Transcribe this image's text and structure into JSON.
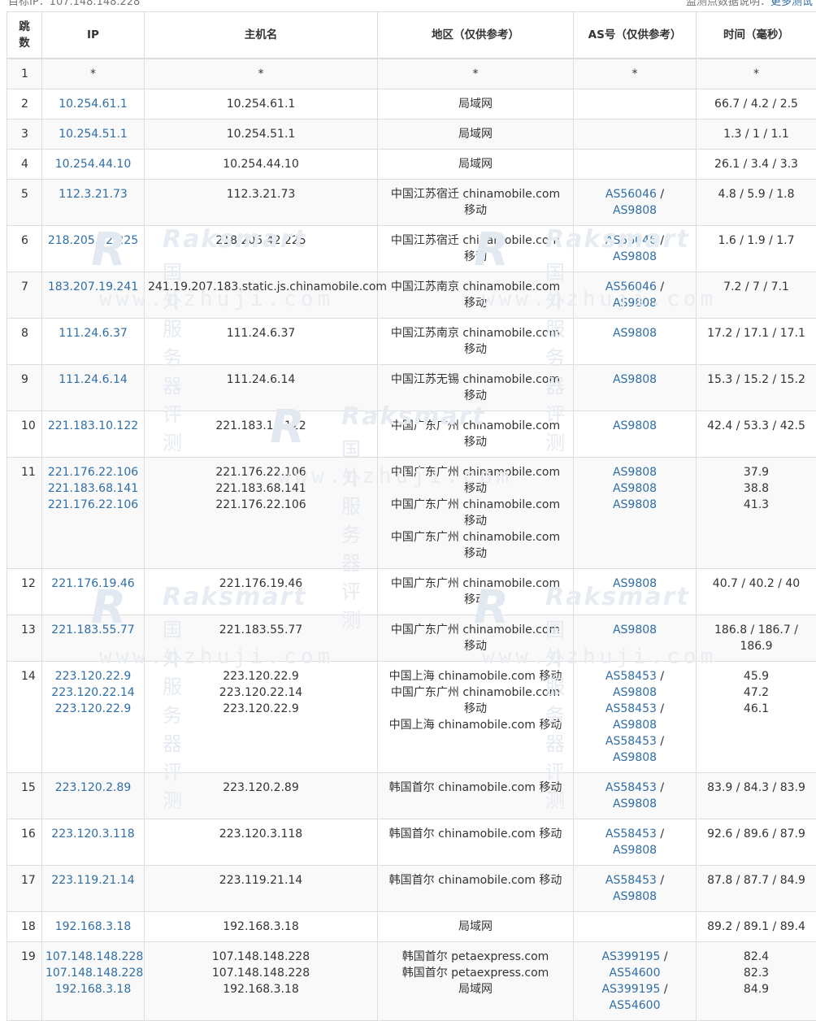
{
  "top_bar": {
    "left_text": "目标IP：107.148.148.228",
    "right_text": "监测点数据说明：",
    "right_link": "更多测试"
  },
  "watermark": {
    "brand": "Raksmart",
    "cn": "国外服务器评测",
    "url": "www.qzhuji.com"
  },
  "table": {
    "headers": [
      "跳数",
      "IP",
      "主机名",
      "地区（仅供参考）",
      "AS号（仅供参考）",
      "时间（毫秒）"
    ],
    "rows": [
      {
        "hop": "1",
        "ips": [
          "*"
        ],
        "hosts": [
          "*"
        ],
        "regions": [
          "*"
        ],
        "as": [
          [
            "*"
          ]
        ],
        "times": [
          "*"
        ]
      },
      {
        "hop": "2",
        "ips": [
          "10.254.61.1"
        ],
        "hosts": [
          "10.254.61.1"
        ],
        "regions": [
          "局域网"
        ],
        "as": [],
        "times": [
          "66.7 / 4.2 / 2.5"
        ]
      },
      {
        "hop": "3",
        "ips": [
          "10.254.51.1"
        ],
        "hosts": [
          "10.254.51.1"
        ],
        "regions": [
          "局域网"
        ],
        "as": [],
        "times": [
          "1.3 / 1 / 1.1"
        ]
      },
      {
        "hop": "4",
        "ips": [
          "10.254.44.10"
        ],
        "hosts": [
          "10.254.44.10"
        ],
        "regions": [
          "局域网"
        ],
        "as": [],
        "times": [
          "26.1 / 3.4 / 3.3"
        ]
      },
      {
        "hop": "5",
        "ips": [
          "112.3.21.73"
        ],
        "hosts": [
          "112.3.21.73"
        ],
        "regions": [
          "中国江苏宿迁 chinamobile.com 移动"
        ],
        "as": [
          [
            "AS56046",
            "AS9808"
          ]
        ],
        "times": [
          "4.8 / 5.9 / 1.8"
        ]
      },
      {
        "hop": "6",
        "ips": [
          "218.205.42.225"
        ],
        "hosts": [
          "218.205.42.225"
        ],
        "regions": [
          "中国江苏宿迁 chinamobile.com 移动"
        ],
        "as": [
          [
            "AS56046",
            "AS9808"
          ]
        ],
        "times": [
          "1.6 / 1.9 / 1.7"
        ]
      },
      {
        "hop": "7",
        "ips": [
          "183.207.19.241"
        ],
        "hosts": [
          "241.19.207.183.static.js.chinamobile.com"
        ],
        "regions": [
          "中国江苏南京 chinamobile.com 移动"
        ],
        "as": [
          [
            "AS56046",
            "AS9808"
          ]
        ],
        "times": [
          "7.2 / 7 / 7.1"
        ]
      },
      {
        "hop": "8",
        "ips": [
          "111.24.6.37"
        ],
        "hosts": [
          "111.24.6.37"
        ],
        "regions": [
          "中国江苏南京 chinamobile.com 移动"
        ],
        "as": [
          [
            "AS9808"
          ]
        ],
        "times": [
          "17.2 / 17.1 / 17.1"
        ]
      },
      {
        "hop": "9",
        "ips": [
          "111.24.6.14"
        ],
        "hosts": [
          "111.24.6.14"
        ],
        "regions": [
          "中国江苏无锡 chinamobile.com 移动"
        ],
        "as": [
          [
            "AS9808"
          ]
        ],
        "times": [
          "15.3 / 15.2 / 15.2"
        ]
      },
      {
        "hop": "10",
        "ips": [
          "221.183.10.122"
        ],
        "hosts": [
          "221.183.10.122"
        ],
        "regions": [
          "中国广东广州 chinamobile.com 移动"
        ],
        "as": [
          [
            "AS9808"
          ]
        ],
        "times": [
          "42.4 / 53.3 / 42.5"
        ]
      },
      {
        "hop": "11",
        "ips": [
          "221.176.22.106",
          "221.183.68.141",
          "221.176.22.106"
        ],
        "hosts": [
          "221.176.22.106",
          "221.183.68.141",
          "221.176.22.106"
        ],
        "regions": [
          "中国广东广州 chinamobile.com 移动",
          "中国广东广州 chinamobile.com 移动",
          "中国广东广州 chinamobile.com 移动"
        ],
        "as": [
          [
            "AS9808"
          ],
          [
            "AS9808"
          ],
          [
            "AS9808"
          ]
        ],
        "times": [
          "37.9",
          "38.8",
          "41.3"
        ]
      },
      {
        "hop": "12",
        "ips": [
          "221.176.19.46"
        ],
        "hosts": [
          "221.176.19.46"
        ],
        "regions": [
          "中国广东广州 chinamobile.com 移动"
        ],
        "as": [
          [
            "AS9808"
          ]
        ],
        "times": [
          "40.7 / 40.2 / 40"
        ]
      },
      {
        "hop": "13",
        "ips": [
          "221.183.55.77"
        ],
        "hosts": [
          "221.183.55.77"
        ],
        "regions": [
          "中国广东广州 chinamobile.com 移动"
        ],
        "as": [
          [
            "AS9808"
          ]
        ],
        "times": [
          "186.8 / 186.7 / 186.9"
        ]
      },
      {
        "hop": "14",
        "ips": [
          "223.120.22.9",
          "223.120.22.14",
          "223.120.22.9"
        ],
        "hosts": [
          "223.120.22.9",
          "223.120.22.14",
          "223.120.22.9"
        ],
        "regions": [
          "中国上海 chinamobile.com 移动",
          "中国广东广州 chinamobile.com 移动",
          "中国上海 chinamobile.com 移动"
        ],
        "as": [
          [
            "AS58453",
            "AS9808"
          ],
          [
            "AS58453",
            "AS9808"
          ],
          [
            "AS58453",
            "AS9808"
          ]
        ],
        "times": [
          "45.9",
          "47.2",
          "46.1"
        ]
      },
      {
        "hop": "15",
        "ips": [
          "223.120.2.89"
        ],
        "hosts": [
          "223.120.2.89"
        ],
        "regions": [
          "韩国首尔 chinamobile.com 移动"
        ],
        "as": [
          [
            "AS58453",
            "AS9808"
          ]
        ],
        "times": [
          "83.9 / 84.3 / 83.9"
        ]
      },
      {
        "hop": "16",
        "ips": [
          "223.120.3.118"
        ],
        "hosts": [
          "223.120.3.118"
        ],
        "regions": [
          "韩国首尔 chinamobile.com 移动"
        ],
        "as": [
          [
            "AS58453",
            "AS9808"
          ]
        ],
        "times": [
          "92.6 / 89.6 / 87.9"
        ]
      },
      {
        "hop": "17",
        "ips": [
          "223.119.21.14"
        ],
        "hosts": [
          "223.119.21.14"
        ],
        "regions": [
          "韩国首尔 chinamobile.com 移动"
        ],
        "as": [
          [
            "AS58453",
            "AS9808"
          ]
        ],
        "times": [
          "87.8 / 87.7 / 84.9"
        ]
      },
      {
        "hop": "18",
        "ips": [
          "192.168.3.18"
        ],
        "hosts": [
          "192.168.3.18"
        ],
        "regions": [
          "局域网"
        ],
        "as": [],
        "times": [
          "89.2 / 89.1 / 89.4"
        ]
      },
      {
        "hop": "19",
        "ips": [
          "107.148.148.228",
          "107.148.148.228",
          "192.168.3.18"
        ],
        "hosts": [
          "107.148.148.228",
          "107.148.148.228",
          "192.168.3.18"
        ],
        "regions": [
          "韩国首尔 petaexpress.com",
          "韩国首尔 petaexpress.com",
          "局域网"
        ],
        "as": [
          [
            "AS399195",
            "AS54600"
          ],
          [
            "AS399195",
            "AS54600"
          ]
        ],
        "times": [
          "82.4",
          "82.3",
          "84.9"
        ]
      }
    ]
  }
}
